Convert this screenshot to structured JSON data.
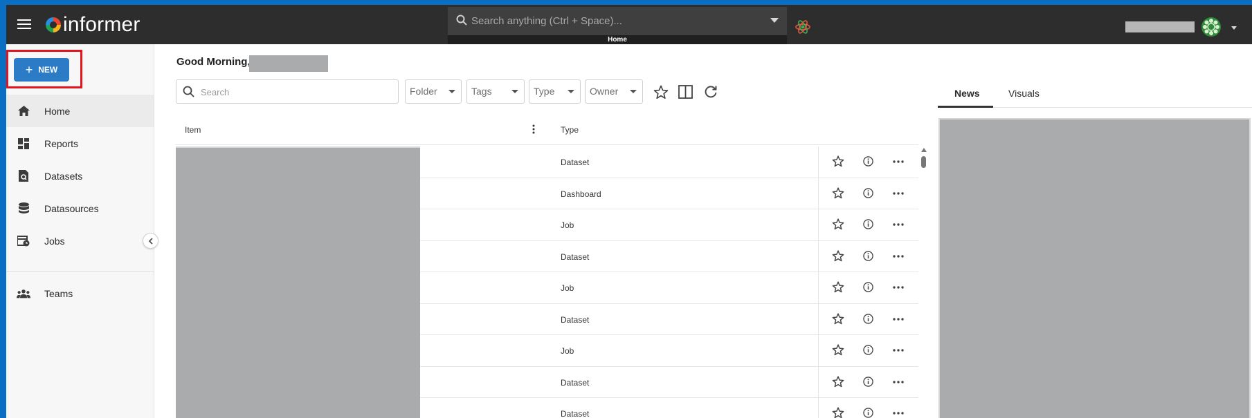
{
  "app": {
    "logo_text": "informer",
    "search_placeholder": "Search anything (Ctrl + Space)...",
    "breadcrumb": "Home"
  },
  "sidebar": {
    "new_label": "NEW",
    "items": [
      {
        "label": "Home",
        "icon": "home-icon",
        "active": true
      },
      {
        "label": "Reports",
        "icon": "reports-icon"
      },
      {
        "label": "Datasets",
        "icon": "datasets-icon"
      },
      {
        "label": "Datasources",
        "icon": "database-icon"
      },
      {
        "label": "Jobs",
        "icon": "jobs-icon"
      },
      {
        "label": "Teams",
        "icon": "teams-icon"
      }
    ]
  },
  "main": {
    "greeting": "Good Morning,",
    "search_placeholder": "Search",
    "filters": [
      "Folder",
      "Tags",
      "Type",
      "Owner"
    ],
    "columns": {
      "item": "Item",
      "type": "Type"
    },
    "rows": [
      {
        "type": "Dataset"
      },
      {
        "type": "Dashboard"
      },
      {
        "type": "Job"
      },
      {
        "type": "Dataset"
      },
      {
        "type": "Job"
      },
      {
        "type": "Dataset"
      },
      {
        "type": "Job"
      },
      {
        "type": "Dataset"
      },
      {
        "type": "Dataset"
      }
    ]
  },
  "right_panel": {
    "tabs": [
      "News",
      "Visuals"
    ]
  },
  "colors": {
    "topbar": "#2d2d2d",
    "new_button": "#2c7bc6",
    "highlight": "#e3141b",
    "redacted": "#a9abad"
  }
}
